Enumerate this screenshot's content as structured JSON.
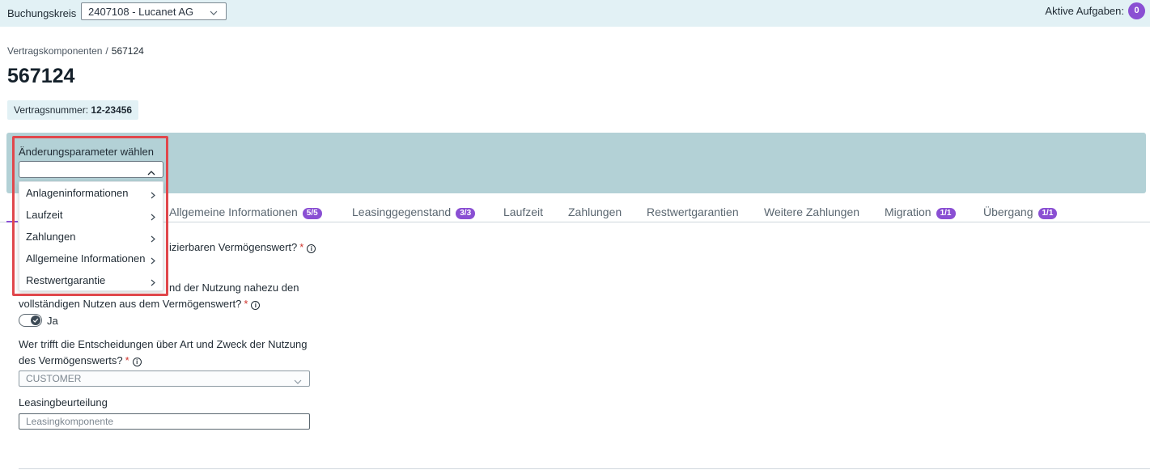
{
  "topbar": {
    "company_code_label": "Buchungskreis",
    "company_code_value": "2407108 - Lucanet AG",
    "tasks_label": "Aktive Aufgaben:",
    "tasks_count": "0"
  },
  "breadcrumb": {
    "parent": "Vertragskomponenten",
    "separator": "/",
    "current": "567124"
  },
  "page_title": "567124",
  "contract": {
    "label": "Vertragsnummer:",
    "value": "12-23456"
  },
  "change_params": {
    "label": "Änderungsparameter wählen",
    "value": "",
    "options": [
      "Anlageninformationen",
      "Laufzeit",
      "Zahlungen",
      "Allgemeine Informationen",
      "Restwertgarantie"
    ]
  },
  "tabs": [
    {
      "label": "Allgemeine Informationen",
      "badge": "5/5"
    },
    {
      "label": "Leasinggegenstand",
      "badge": "3/3"
    },
    {
      "label": "Laufzeit",
      "badge": ""
    },
    {
      "label": "Zahlungen",
      "badge": ""
    },
    {
      "label": "Restwertgarantien",
      "badge": ""
    },
    {
      "label": "Weitere Zahlungen",
      "badge": ""
    },
    {
      "label": "Migration",
      "badge": "1/1"
    },
    {
      "label": "Übergang",
      "badge": "1/1"
    }
  ],
  "form": {
    "q1_visible_text": "izierbaren Vermögenswert?",
    "q2_line1_visible": "nd der Nutzung nahezu den",
    "q2_line2": "vollständigen Nutzen aus dem Vermögenswert?",
    "q2_answer": "Ja",
    "q3_line1": "Wer trifft die Entscheidungen über Art und Zweck der Nutzung",
    "q3_line2": "des Vermögenswerts?",
    "q3_value": "CUSTOMER",
    "assessment_label": "Leasingbeurteilung",
    "assessment_value": "Leasingkomponente",
    "required_mark": "*",
    "info_glyph": "i"
  },
  "colors": {
    "accent": "#8a4fd3",
    "topbar_bg": "#e2f1f5",
    "panel_bg": "#b3d1d6",
    "highlight_border": "#e0474c",
    "required": "#d0342c"
  }
}
